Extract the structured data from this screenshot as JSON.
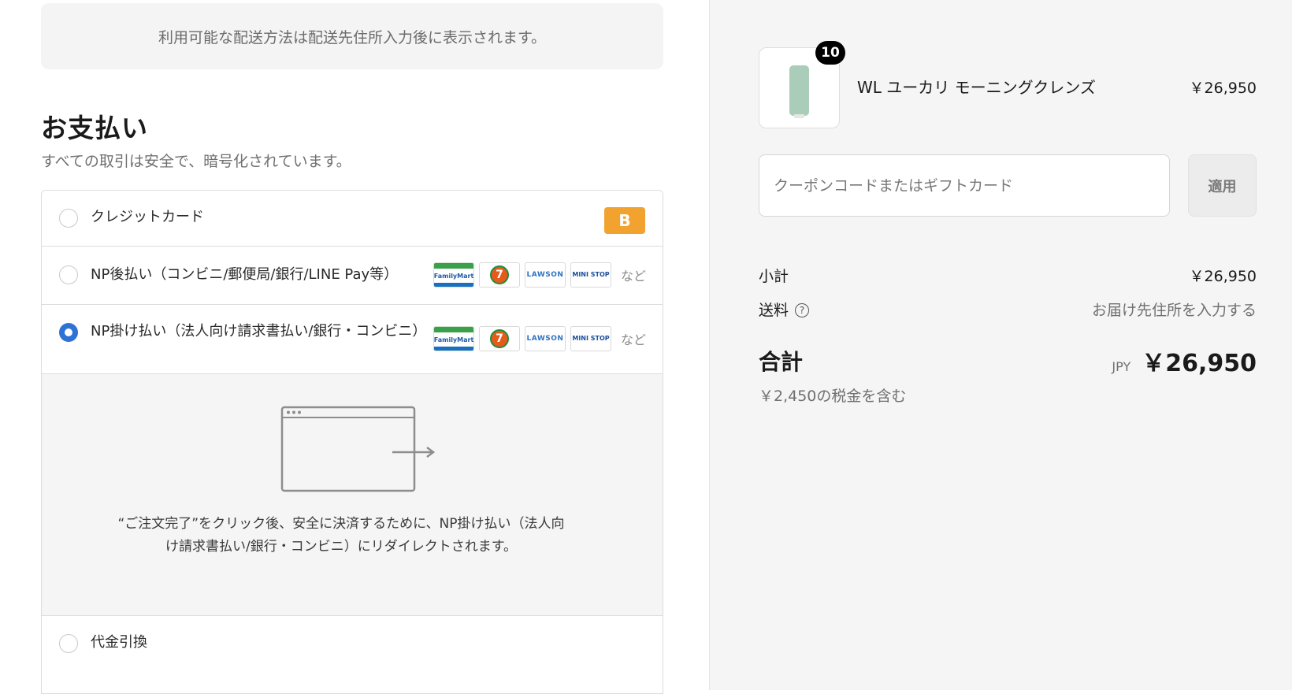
{
  "shipping_notice": "利用可能な配送方法は配送先住所入力後に表示されます。",
  "payment": {
    "title": "お支払い",
    "subtitle": "すべての取引は安全で、暗号化されています。",
    "methods": [
      {
        "label": "クレジットカード",
        "selected": false,
        "badge": "B"
      },
      {
        "label": "NP後払い（コンビニ/郵便局/銀行/LINE Pay等）",
        "selected": false,
        "suffix": "など"
      },
      {
        "label": "NP掛け払い（法人向け請求書払い/銀行・コンビニ）",
        "selected": true,
        "suffix": "など"
      },
      {
        "label": "代金引換",
        "selected": false
      }
    ],
    "store_logos": [
      "FamilyMart",
      "7",
      "LAWSON",
      "MINI STOP"
    ],
    "redirect_message": "“ご注文完了”をクリック後、安全に決済するために、NP掛け払い（法人向け請求書払い/銀行・コンビニ）にリダイレクトされます。"
  },
  "order": {
    "product": {
      "name": "WL ユーカリ モーニングクレンズ",
      "price": "￥26,950",
      "quantity": "10"
    },
    "coupon": {
      "placeholder": "クーポンコードまたはギフトカード",
      "apply_label": "適用"
    },
    "subtotal": {
      "label": "小計",
      "value": "￥26,950"
    },
    "shipping": {
      "label": "送料",
      "value": "お届け先住所を入力する"
    },
    "total": {
      "label": "合計",
      "currency": "JPY",
      "value": "￥26,950"
    },
    "tax_note": "￥2,450の税金を含む"
  },
  "colors": {
    "accent": "#2f72d6",
    "badge": "#f1a22f"
  },
  "icons": [
    "radio-icon",
    "help-icon",
    "browser-redirect-icon"
  ]
}
